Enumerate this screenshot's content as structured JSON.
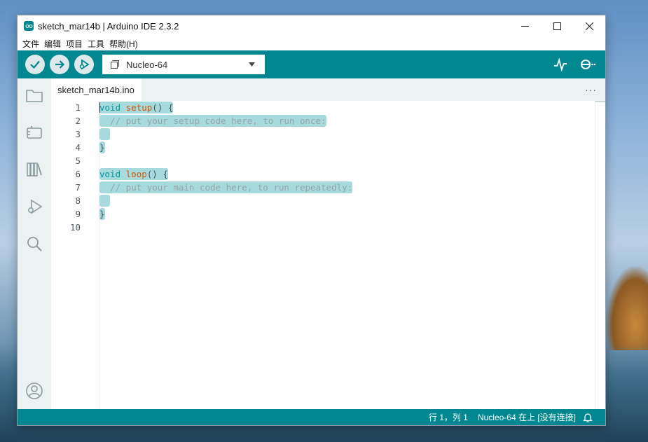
{
  "window": {
    "title": "sketch_mar14b | Arduino IDE 2.3.2"
  },
  "menu": [
    "文件",
    "编辑",
    "项目",
    "工具",
    "帮助(H)"
  ],
  "toolbar": {
    "board": "Nucleo-64"
  },
  "tab": {
    "filename": "sketch_mar14b.ino",
    "more": "···"
  },
  "editor": {
    "line_numbers": [
      "1",
      "2",
      "3",
      "4",
      "5",
      "6",
      "7",
      "8",
      "9",
      "10"
    ]
  },
  "status": {
    "position": "行 1，列 1",
    "board_status": "Nucleo-64 在上 [没有连接]"
  },
  "colors": {
    "accent": "#00878f",
    "selection": "#a7dadc"
  },
  "icons": [
    "verify-icon",
    "upload-icon",
    "debug-icon",
    "board-icon",
    "dropdown-caret-icon",
    "serial-plotter-icon",
    "serial-monitor-icon",
    "folder-icon",
    "boards-manager-icon",
    "library-manager-icon",
    "debug-sidebar-icon",
    "search-icon",
    "profile-icon",
    "bell-icon"
  ]
}
